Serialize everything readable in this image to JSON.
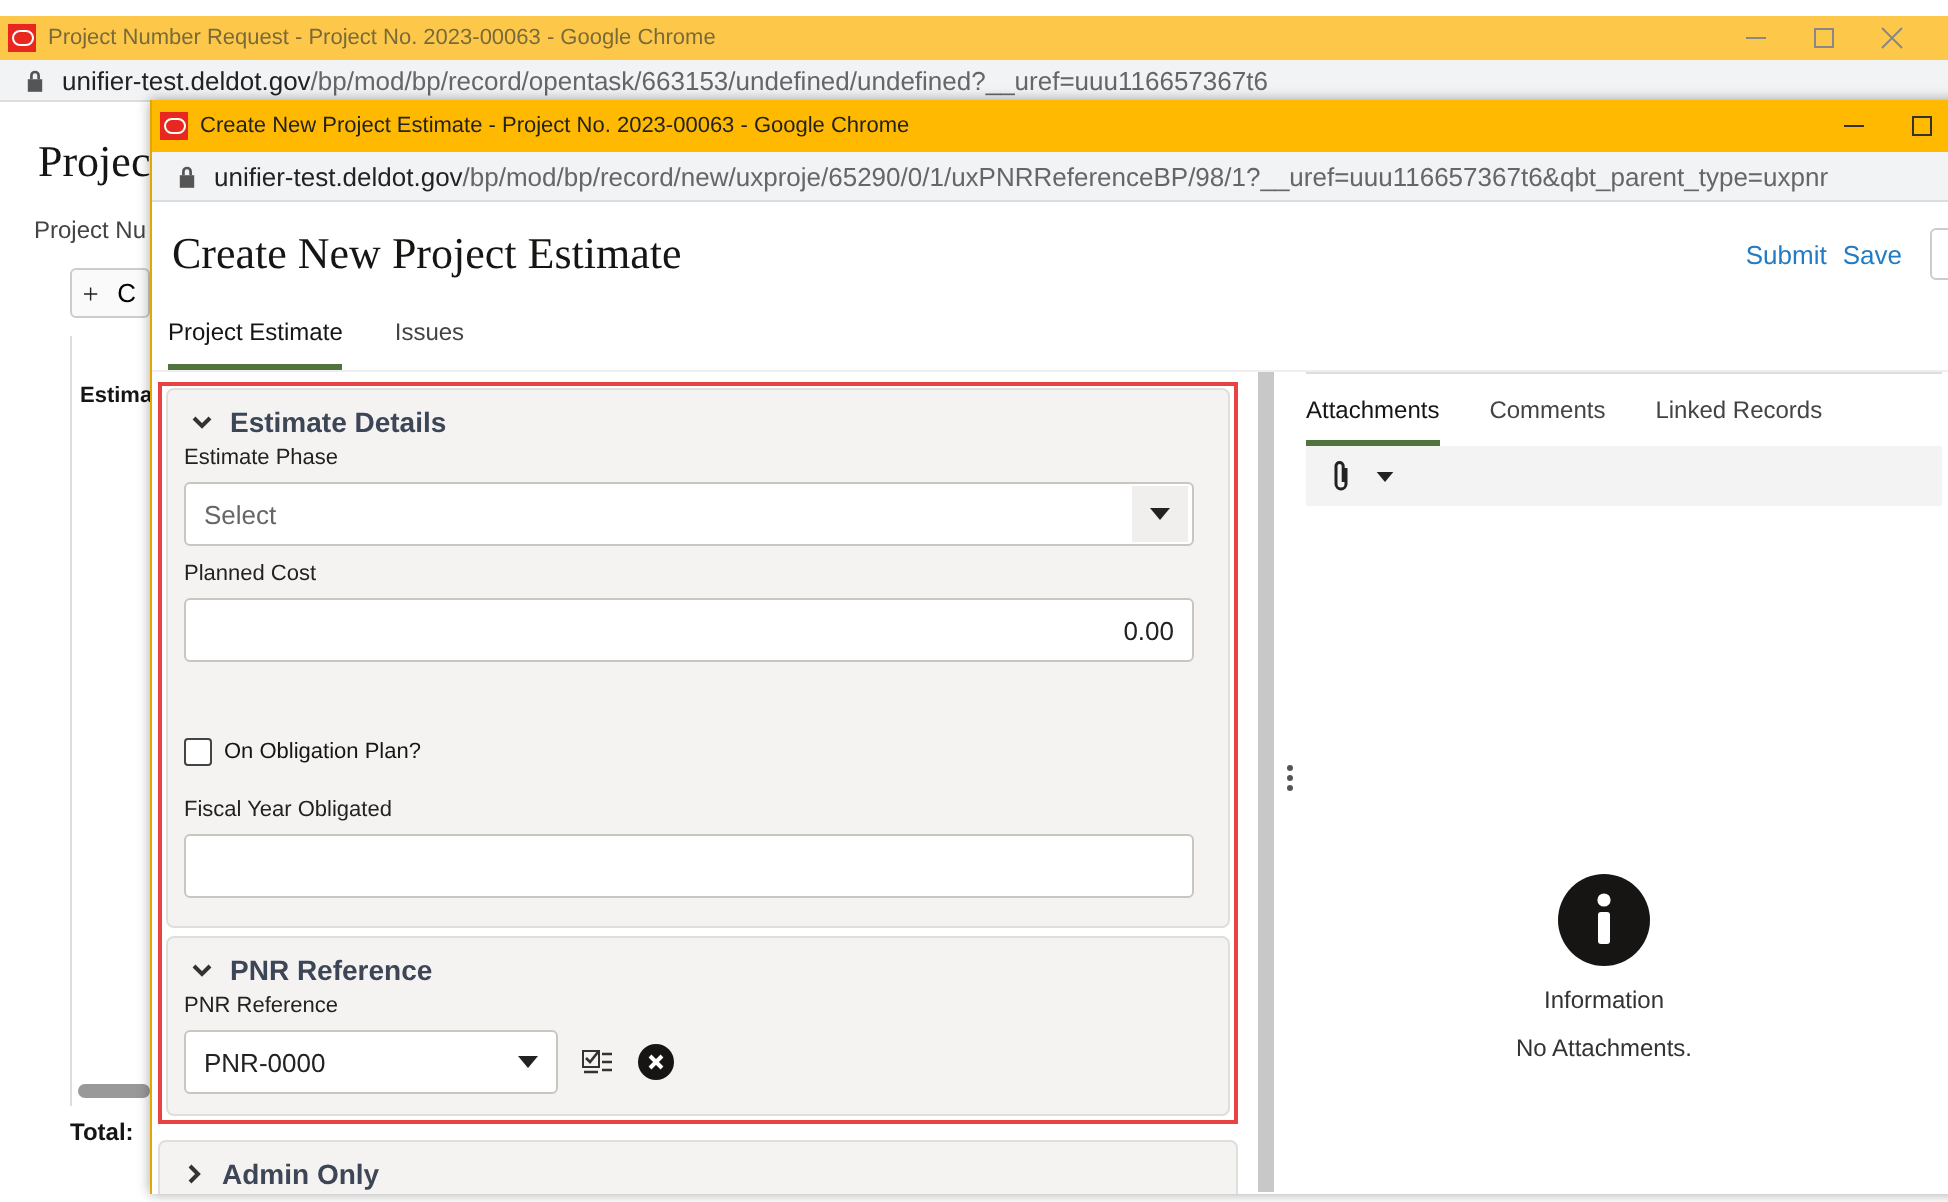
{
  "back_window": {
    "title": "Project Number Request - Project No. 2023-00063 - Google Chrome",
    "address_host": "unifier-test.deldot.gov",
    "address_path": "/bp/mod/bp/record/opentask/663153/undefined/undefined?__uref=uuu116657367t6",
    "heading": "Projec",
    "subtitle": "Project Nu",
    "add_button": "C",
    "column_1": "Estima",
    "total": "Total:"
  },
  "window": {
    "title": "Create New Project Estimate - Project No. 2023-00063 - Google Chrome",
    "address_host": "unifier-test.deldot.gov",
    "address_path": "/bp/mod/bp/record/new/uxproje/65290/0/1/uxPNRReferenceBP/98/1?__uref=uuu116657367t6&qbt_parent_type=uxpnr",
    "heading": "Create New Project Estimate",
    "actions": [
      {
        "label": "Submit"
      },
      {
        "label": "Save"
      }
    ],
    "tabs": [
      {
        "label": "Project Estimate",
        "selected": true
      },
      {
        "label": "Issues",
        "selected": false
      }
    ],
    "sections": [
      {
        "title": "Estimate Details",
        "expanded": true,
        "highlighted": true,
        "fields": [
          {
            "kind": "select",
            "label": "Estimate Phase",
            "placeholder": "Select"
          },
          {
            "kind": "number",
            "label": "Planned Cost",
            "value": "0.00"
          },
          {
            "kind": "checkbox",
            "label": "On Obligation Plan?",
            "checked": false
          },
          {
            "kind": "text",
            "label": "Fiscal Year Obligated"
          }
        ]
      },
      {
        "title": "PNR Reference",
        "expanded": true,
        "highlighted": true,
        "fields": [
          {
            "kind": "picker",
            "label": "PNR Reference",
            "value": "PNR-0000"
          }
        ]
      },
      {
        "title": "Admin Only",
        "expanded": false,
        "highlighted": false
      }
    ],
    "side_tabs": [
      {
        "label": "Attachments",
        "selected": true
      },
      {
        "label": "Comments",
        "selected": false
      },
      {
        "label": "Linked Records",
        "selected": false
      }
    ],
    "empty_state": {
      "title": "Information",
      "message": "No Attachments."
    }
  }
}
